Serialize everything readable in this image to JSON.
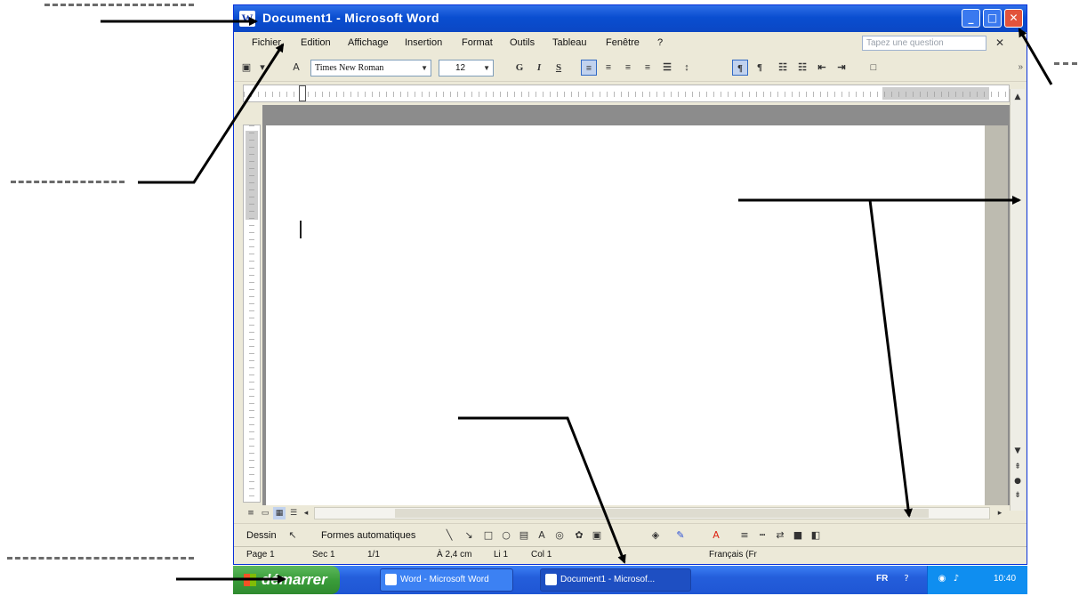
{
  "window": {
    "title": "Document1 - Microsoft Word",
    "controls": {
      "minimize": "_",
      "maximize": "□",
      "close": "✕"
    }
  },
  "menubar": {
    "items": [
      "Fichier",
      "Edition",
      "Affichage",
      "Insertion",
      "Format",
      "Outils",
      "Tableau",
      "Fenêtre",
      "?"
    ],
    "help_placeholder": "Tapez une question",
    "close_doc": "✕"
  },
  "toolbar": {
    "font": "Times New Roman",
    "size": "12",
    "bold": "G",
    "italic": "I",
    "underline": "S"
  },
  "drawing_toolbar": {
    "dessin": "Dessin",
    "formes": "Formes automatiques"
  },
  "statusbar": {
    "page": "Page 1",
    "section": "Sec 1",
    "pages": "1/1",
    "position": "À 2,4 cm",
    "line": "Li 1",
    "column": "Col 1",
    "language": "Français (Fr"
  },
  "taskbar": {
    "start": "démarrer",
    "tasks": [
      "Word - Microsoft Word",
      "Document1 - Microsof..."
    ],
    "lang": "FR",
    "clock": "10:40"
  },
  "colors": {
    "titlebar": "#0a4ed0",
    "chrome": "#ece9d8",
    "taskbar": "#245edb",
    "start_button": "#3a9d3a"
  }
}
